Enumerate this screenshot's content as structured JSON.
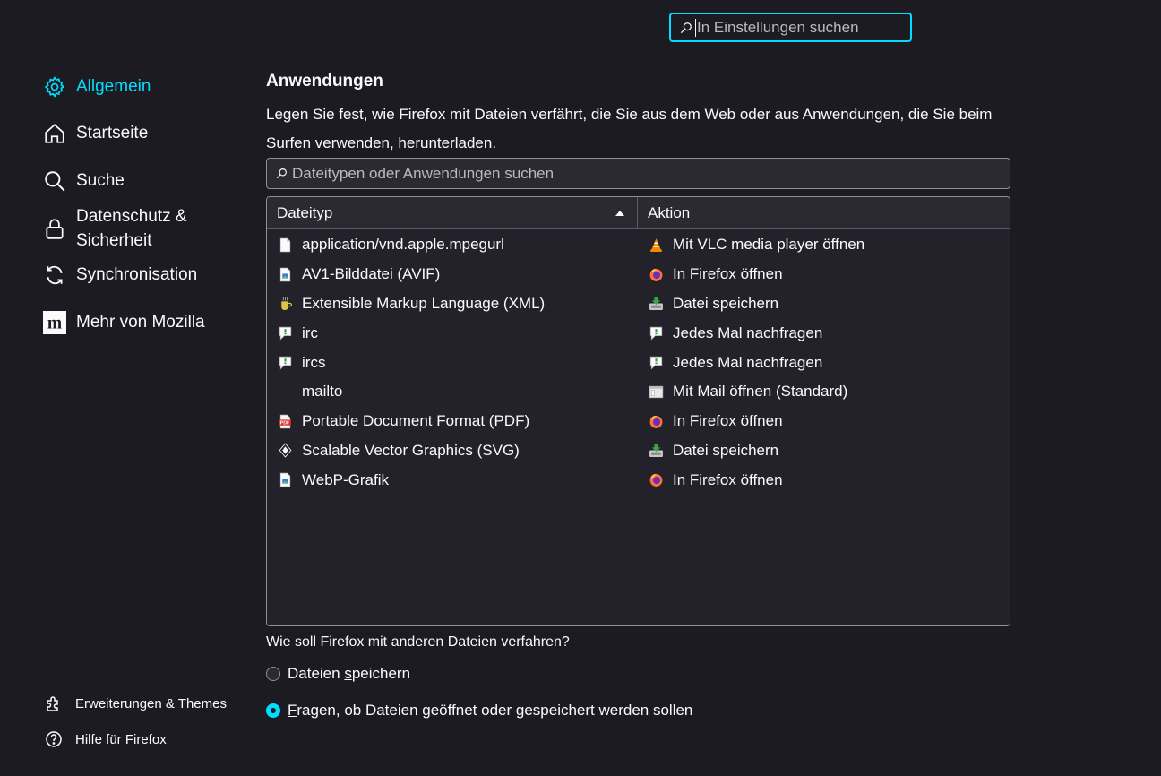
{
  "search": {
    "placeholder": "In Einstellungen suchen"
  },
  "sidebar": {
    "items": [
      {
        "label": "Allgemein",
        "icon": "gear-icon",
        "active": true
      },
      {
        "label": "Startseite",
        "icon": "home-icon"
      },
      {
        "label": "Suche",
        "icon": "search-icon"
      },
      {
        "label": "Datenschutz &",
        "label2": "Sicherheit",
        "icon": "lock-icon"
      },
      {
        "label": "Synchronisation",
        "icon": "sync-icon"
      },
      {
        "label": "Mehr von Mozilla",
        "icon": "mozilla-icon"
      }
    ],
    "footer": [
      {
        "label": "Erweiterungen & Themes",
        "icon": "puzzle-icon"
      },
      {
        "label": "Hilfe für Firefox",
        "icon": "help-icon"
      }
    ]
  },
  "main": {
    "heading": "Anwendungen",
    "description": "Legen Sie fest, wie Firefox mit Dateien verfährt, die Sie aus dem Web oder aus Anwendungen, die Sie beim Surfen verwenden, herunterladen.",
    "filter_placeholder": "Dateitypen oder Anwendungen suchen",
    "table": {
      "columns": [
        "Dateityp",
        "Aktion"
      ],
      "rows": [
        {
          "type": "application/vnd.apple.mpegurl",
          "type_icon": "file-icon",
          "action": "Mit VLC media player öffnen",
          "action_icon": "vlc-icon"
        },
        {
          "type": "AV1-Bilddatei (AVIF)",
          "type_icon": "image-file-icon",
          "action": "In Firefox öffnen",
          "action_icon": "firefox-icon"
        },
        {
          "type": "Extensible Markup Language (XML)",
          "type_icon": "xml-icon",
          "action": "Datei speichern",
          "action_icon": "save-icon"
        },
        {
          "type": "irc",
          "type_icon": "chat-icon",
          "action": "Jedes Mal nachfragen",
          "action_icon": "ask-icon"
        },
        {
          "type": "ircs",
          "type_icon": "chat-icon",
          "action": "Jedes Mal nachfragen",
          "action_icon": "ask-icon"
        },
        {
          "type": "mailto",
          "type_icon": "",
          "action": "Mit Mail öffnen (Standard)",
          "action_icon": "mail-app-icon"
        },
        {
          "type": "Portable Document Format (PDF)",
          "type_icon": "pdf-icon",
          "action": "In Firefox öffnen",
          "action_icon": "firefox-icon"
        },
        {
          "type": "Scalable Vector Graphics (SVG)",
          "type_icon": "svg-icon",
          "action": "Datei speichern",
          "action_icon": "save-icon"
        },
        {
          "type": "WebP-Grafik",
          "type_icon": "image-file-icon",
          "action": "In Firefox öffnen",
          "action_icon": "firefox-icon"
        }
      ]
    },
    "question": "Wie soll Firefox mit anderen Dateien verfahren?",
    "radio_save_pre": "Dateien ",
    "radio_save_ul": "s",
    "radio_save_post": "peichern",
    "radio_ask_ul": "F",
    "radio_ask_post": "ragen, ob Dateien geöffnet oder gespeichert werden sollen",
    "selected_option": "ask"
  },
  "colors": {
    "accent": "#00ddff",
    "background": "#1c1b22",
    "text": "#fbfbfe"
  }
}
